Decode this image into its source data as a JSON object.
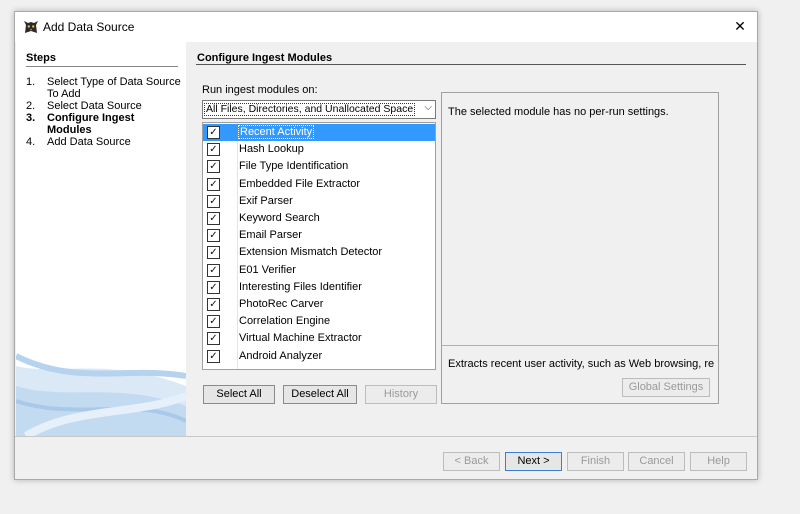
{
  "window": {
    "title": "Add Data Source",
    "close_glyph": "✕",
    "icon": "autopsy-dog-icon"
  },
  "steps": {
    "title": "Steps",
    "items": [
      {
        "num": "1.",
        "label": "Select Type of Data Source To Add",
        "current": false
      },
      {
        "num": "2.",
        "label": "Select Data Source",
        "current": false
      },
      {
        "num": "3.",
        "label": "Configure Ingest Modules",
        "current": true
      },
      {
        "num": "4.",
        "label": "Add Data Source",
        "current": false
      }
    ]
  },
  "main": {
    "title": "Configure Ingest Modules",
    "run_label": "Run ingest modules on:",
    "run_selected": "All Files, Directories, and Unallocated Space",
    "modules": [
      {
        "label": "Recent Activity",
        "checked": true,
        "selected": true
      },
      {
        "label": "Hash Lookup",
        "checked": true
      },
      {
        "label": "File Type Identification",
        "checked": true
      },
      {
        "label": "Embedded File Extractor",
        "checked": true
      },
      {
        "label": "Exif Parser",
        "checked": true
      },
      {
        "label": "Keyword Search",
        "checked": true
      },
      {
        "label": "Email Parser",
        "checked": true
      },
      {
        "label": "Extension Mismatch Detector",
        "checked": true
      },
      {
        "label": "E01 Verifier",
        "checked": true
      },
      {
        "label": "Interesting Files Identifier",
        "checked": true
      },
      {
        "label": "PhotoRec Carver",
        "checked": true
      },
      {
        "label": "Correlation Engine",
        "checked": true
      },
      {
        "label": "Virtual Machine Extractor",
        "checked": true
      },
      {
        "label": "Android Analyzer",
        "checked": true
      }
    ],
    "select_all": "Select All",
    "deselect_all": "Deselect All",
    "history": "History",
    "settings_msg": "The selected module has no per-run settings.",
    "description": "Extracts recent user activity, such as Web browsing, recentl...",
    "global_settings": "Global Settings"
  },
  "footer": {
    "back": "< Back",
    "next": "Next >",
    "finish": "Finish",
    "cancel": "Cancel",
    "help": "Help"
  },
  "colors": {
    "selection": "#3399ff"
  }
}
